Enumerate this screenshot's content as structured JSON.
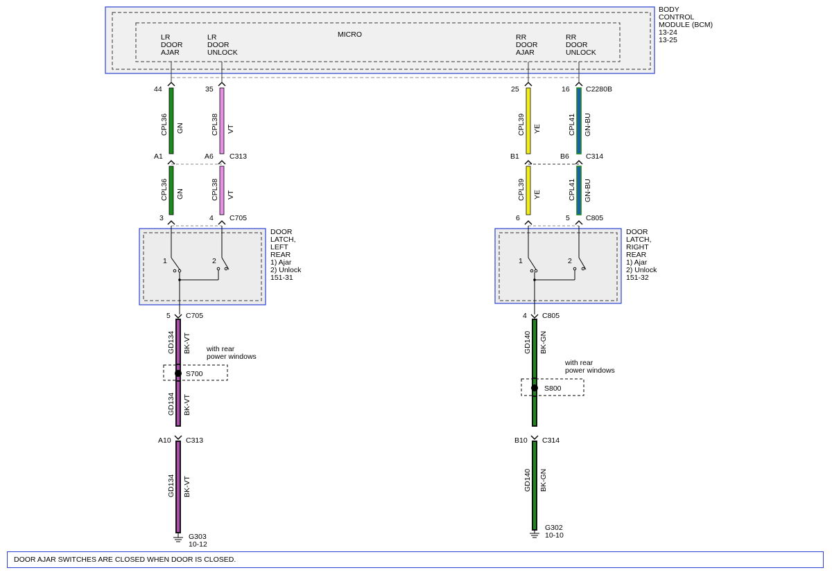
{
  "bcm": {
    "name_lines": [
      "BODY",
      "CONTROL",
      "MODULE (BCM)",
      "13-24",
      "13-25"
    ],
    "micro": "MICRO",
    "pins": {
      "lr_ajar": [
        "LR",
        "DOOR",
        "AJAR"
      ],
      "lr_unlock": [
        "LR",
        "DOOR",
        "UNLOCK"
      ],
      "rr_ajar": [
        "RR",
        "DOOR",
        "AJAR"
      ],
      "rr_unlock": [
        "RR",
        "DOOR",
        "UNLOCK"
      ]
    }
  },
  "connectors": {
    "bcm": "C2280B",
    "lr_inline": "C313",
    "lr_latch": "C705",
    "rr_inline": "C314",
    "rr_latch": "C805"
  },
  "pin_numbers": {
    "lr_ajar_bcm": "44",
    "lr_unlock_bcm": "35",
    "rr_ajar_bcm": "25",
    "rr_unlock_bcm": "16",
    "lr_ajar_inline": "A1",
    "lr_unlock_inline": "A6",
    "rr_ajar_inline": "B1",
    "rr_unlock_inline": "B6",
    "lr_ajar_latch": "3",
    "lr_unlock_latch": "4",
    "rr_ajar_latch": "6",
    "rr_unlock_latch": "5",
    "lr_ground_latch": "5",
    "rr_ground_latch": "4",
    "lr_ground_inline": "A10",
    "rr_ground_inline": "B10"
  },
  "wires": {
    "cpl36": {
      "circuit": "CPL36",
      "color": "GN"
    },
    "cpl38": {
      "circuit": "CPL38",
      "color": "VT"
    },
    "cpl39": {
      "circuit": "CPL39",
      "color": "YE"
    },
    "cpl41": {
      "circuit": "CPL41",
      "color": "GN-BU"
    },
    "gd134": {
      "circuit": "GD134",
      "color": "BK-VT"
    },
    "gd140": {
      "circuit": "GD140",
      "color": "BK-GN"
    }
  },
  "latches": {
    "left": [
      "DOOR",
      "LATCH,",
      "LEFT",
      "REAR",
      "1) Ajar",
      "2) Unlock",
      "151-31"
    ],
    "right": [
      "DOOR",
      "LATCH,",
      "RIGHT",
      "REAR",
      "1) Ajar",
      "2) Unlock",
      "151-32"
    ],
    "switch_1": "1",
    "switch_2": "2"
  },
  "splices": {
    "left": "S700",
    "right": "S800",
    "note": [
      "with rear",
      "power windows"
    ]
  },
  "grounds": {
    "left": [
      "G303",
      "10-12"
    ],
    "right": [
      "G302",
      "10-10"
    ]
  },
  "colors": {
    "blue_border": "#2a3fd6",
    "green": "#1e8a1e",
    "violet": "#e58ee5",
    "yellow": "#f2ee1a",
    "green_blue": "#1c5fae",
    "black": "#111111"
  },
  "footer_note": "DOOR AJAR SWITCHES ARE CLOSED WHEN DOOR IS CLOSED."
}
